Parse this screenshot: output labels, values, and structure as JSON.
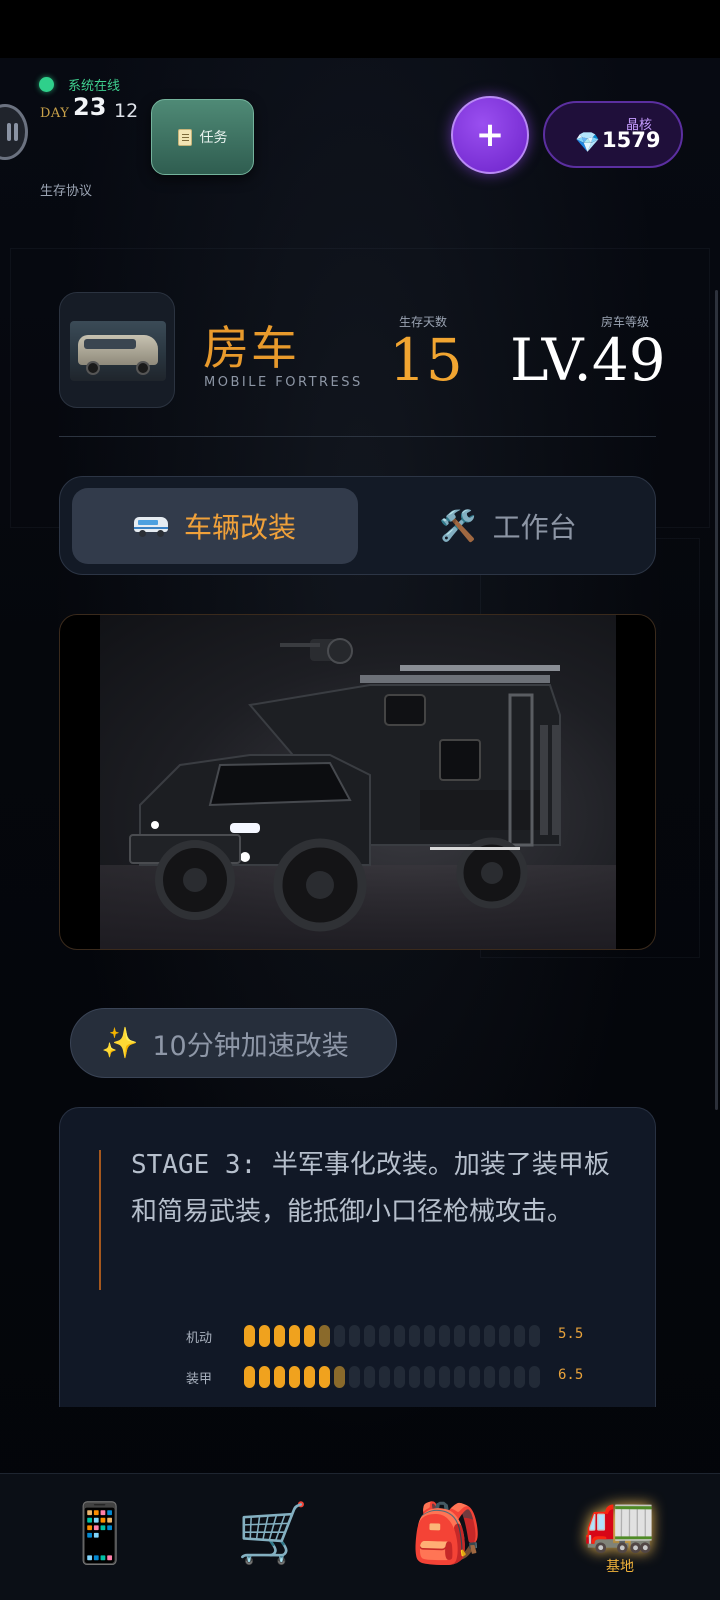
{
  "hud": {
    "online_text": "系统在线",
    "day_label": "DAY",
    "day_value": "23",
    "hour_value": "12",
    "protocol": "生存协议",
    "task_label": "任务",
    "plus_label": "+",
    "crystal_label": "晶核",
    "crystal_icon": "💎",
    "crystal_value": "1579"
  },
  "vehicle": {
    "name": "房车",
    "subtitle": "MOBILE FORTRESS",
    "days_label": "生存天数",
    "days_value": "15",
    "level_label": "房车等级",
    "level_value": "LV.49"
  },
  "tabs": [
    {
      "label": "车辆改装",
      "icon": "van-icon",
      "active": true
    },
    {
      "label": "工作台",
      "icon": "tools-icon",
      "glyph": "🛠️",
      "active": false
    }
  ],
  "speed_up": {
    "icon": "✨",
    "label": "10分钟加速改装"
  },
  "description": {
    "text": "STAGE 3: 半军事化改装。加装了装甲板和简易武装，能抵御小口径枪械攻击。"
  },
  "stats": [
    {
      "label": "机动",
      "value": "5.5",
      "level": 5.5,
      "max": 20
    },
    {
      "label": "装甲",
      "value": "6.5",
      "level": 6.5,
      "max": 20
    }
  ],
  "nav": [
    {
      "name": "phone",
      "glyph": "📱",
      "label": ""
    },
    {
      "name": "shop",
      "glyph": "🛒",
      "label": ""
    },
    {
      "name": "backpack",
      "glyph": "🎒",
      "label": ""
    },
    {
      "name": "base",
      "glyph": "🚛",
      "label": "基地"
    }
  ],
  "colors": {
    "accent_orange": "#f0a13a",
    "online_green": "#2fd08b",
    "crystal_purple": "#6c22c9"
  }
}
